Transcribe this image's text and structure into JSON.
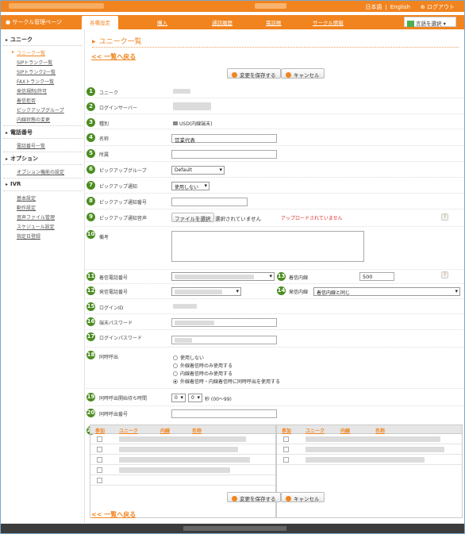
{
  "topbar": {
    "lang_ja": "日本語",
    "lang_sep": "|",
    "lang_en": "English",
    "logout": "⊕ ログアウト"
  },
  "nav": {
    "home": "サークル管理ページ",
    "tabs": [
      "各種設定",
      "購入",
      "通話履歴",
      "電話帳",
      "サークル情報"
    ],
    "language_select": "言語を選択"
  },
  "sidebar": {
    "sections": [
      {
        "title": "ユニーク",
        "items": [
          "ユニーク一覧",
          "SIPトランク一覧",
          "SIPトランク2一覧",
          "FAXトランク一覧",
          "発信規制/許可",
          "着信拒否",
          "ピックアップグループ",
          "内線状態の変更"
        ]
      },
      {
        "title": "電話番号",
        "items": [
          "電話番号一覧"
        ]
      },
      {
        "title": "オプション",
        "items": [
          "オプション機能の設定"
        ]
      },
      {
        "title": "IVR",
        "items": [
          "基本設定",
          "動作設定",
          "音声ファイル管理",
          "スケジュール設定",
          "指定日登録"
        ]
      }
    ]
  },
  "main": {
    "title": "ユニーク一覧",
    "back_link": "<< 一覧へ戻る",
    "save_button": "変更を保存する",
    "cancel_button": "キャンセル",
    "fields": {
      "f1": {
        "num": "1",
        "label": "ユニーク"
      },
      "f2": {
        "num": "2",
        "label": "ログインサーバー"
      },
      "f3": {
        "num": "3",
        "label": "種別",
        "value": "USD(内線端末)"
      },
      "f4": {
        "num": "4",
        "label": "名称",
        "value": "営業代表"
      },
      "f5": {
        "num": "5",
        "label": "所属",
        "value": ""
      },
      "f6": {
        "num": "6",
        "label": "ピックアップグループ",
        "value": "Default"
      },
      "f7": {
        "num": "7",
        "label": "ピックアップ通知",
        "value": "使用しない"
      },
      "f8": {
        "num": "8",
        "label": "ピックアップ通知番号",
        "value": ""
      },
      "f9": {
        "num": "9",
        "label": "ピックアップ通知音声",
        "file_button": "ファイルを選択",
        "file_status": "選択されていません",
        "upload_status": "アップロードされていません"
      },
      "f10": {
        "num": "10",
        "label": "備考",
        "value": ""
      },
      "f11": {
        "num": "11",
        "label": "着信電話番号"
      },
      "f12": {
        "num": "12",
        "label": "発信電話番号"
      },
      "f13": {
        "num": "13",
        "label": "着信内線",
        "value": "500"
      },
      "f14": {
        "num": "14",
        "label": "発信内線",
        "value": "着信内線と同じ"
      },
      "f15": {
        "num": "15",
        "label": "ログインID"
      },
      "f16": {
        "num": "16",
        "label": "端末パスワード"
      },
      "f17": {
        "num": "17",
        "label": "ログインパスワード"
      },
      "f18": {
        "num": "18",
        "label": "同時呼出",
        "options": [
          "使用しない",
          "外線着信時のみ使用する",
          "内線着信時のみ使用する",
          "外線着信時・内線着信時に同時呼出を使用する"
        ],
        "selected": 3
      },
      "f19": {
        "num": "19",
        "label": "同時呼出開始待ち時間",
        "value1": "0",
        "value2": "0",
        "suffix": "秒 (00〜99)"
      },
      "f20": {
        "num": "20",
        "label": "同時呼出番号",
        "value": ""
      },
      "f21": {
        "num": "21",
        "columns": [
          "参加",
          "ユニーク",
          "内線",
          "名称"
        ]
      }
    },
    "help": "?"
  },
  "colors": {
    "accent": "#f1841f",
    "badge": "#4c8d22"
  }
}
